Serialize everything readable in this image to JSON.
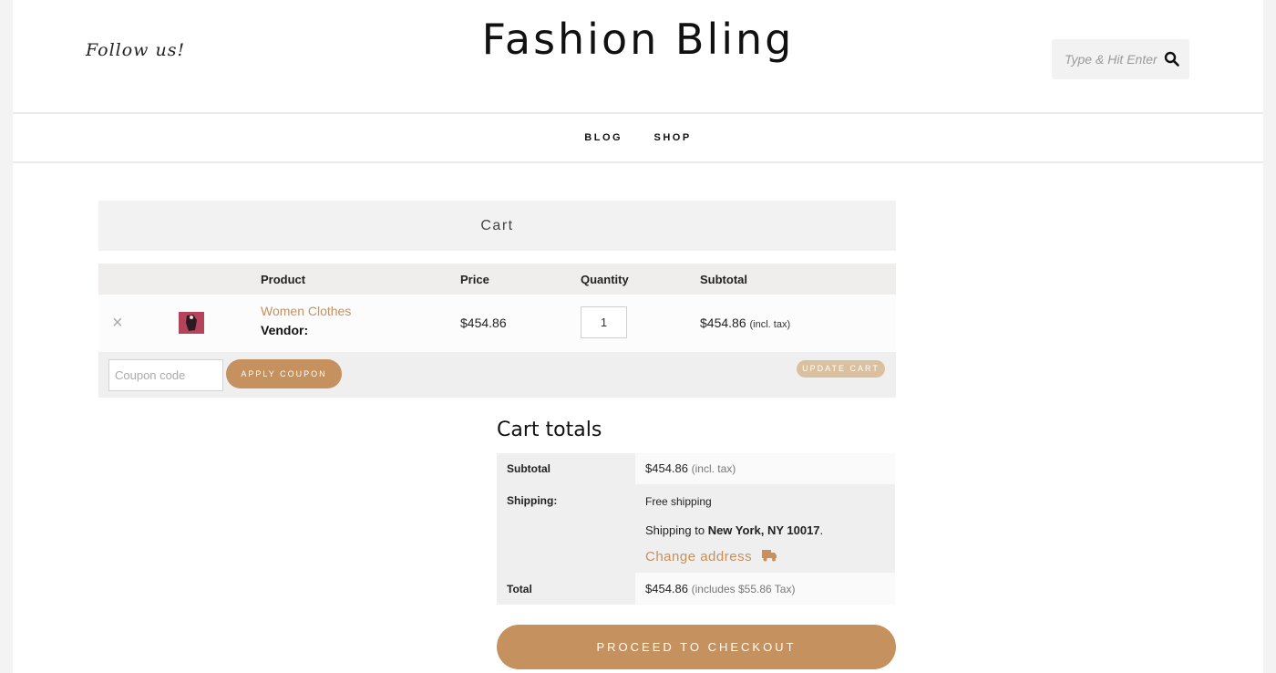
{
  "header": {
    "follow_text": "Follow us!",
    "site_title": "Fashion Bling",
    "search_placeholder": "Type & Hit Enter ..."
  },
  "nav": {
    "items": [
      {
        "label": "BLOG"
      },
      {
        "label": "SHOP"
      }
    ]
  },
  "cart": {
    "title": "Cart",
    "columns": {
      "product": "Product",
      "price": "Price",
      "quantity": "Quantity",
      "subtotal": "Subtotal"
    },
    "items": [
      {
        "remove_glyph": "×",
        "name": "Women Clothes",
        "vendor_label": "Vendor:",
        "price": "$454.86",
        "quantity": "1",
        "subtotal": "$454.86",
        "subtotal_note": "(incl. tax)"
      }
    ],
    "coupon_placeholder": "Coupon code",
    "apply_coupon_label": "APPLY COUPON",
    "update_cart_label": "UPDATE CART"
  },
  "totals": {
    "title": "Cart totals",
    "subtotal_label": "Subtotal",
    "subtotal_value": "$454.86",
    "subtotal_note": "(incl. tax)",
    "shipping_label": "Shipping:",
    "shipping_method": "Free shipping",
    "shipping_to_prefix": "Shipping to",
    "shipping_destination": "New York, NY 10017",
    "shipping_to_suffix": ".",
    "change_address_label": "Change address",
    "total_label": "Total",
    "total_value": "$454.86",
    "total_note": "(includes $55.86 Tax)",
    "checkout_label": "PROCEED TO CHECKOUT"
  },
  "colors": {
    "accent": "#c4915f",
    "accent_light": "#dbc0a0",
    "panel": "#efefef"
  }
}
